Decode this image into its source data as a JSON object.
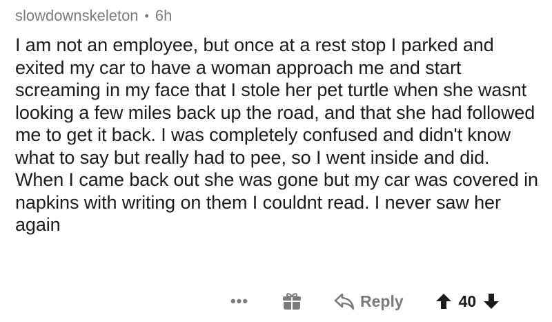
{
  "comment": {
    "author": "slowdownskeleton",
    "separator": "•",
    "age": "6h",
    "text": "I am not an employee,  but once at a rest stop I parked and exited my car to have a woman approach me and start screaming in my face that I stole her pet turtle when she wasnt looking a few miles back up the road, and that she had followed me to get it back. I was completely confused and didn't know what to say but really had to pee, so I went inside and did. When I came back out she was gone but my car was covered in napkins with writing on them I couldnt read. I never saw her again"
  },
  "actions": {
    "more_label": "•••",
    "gift_icon": "gift-icon",
    "reply_icon": "reply-arrow-icon",
    "reply_label": "Reply",
    "upvote_icon": "upvote-arrow-icon",
    "score": "40",
    "downvote_icon": "downvote-arrow-icon"
  },
  "colors": {
    "text": "#1c1c1c",
    "meta": "#7c7c7c",
    "background": "#ffffff"
  }
}
